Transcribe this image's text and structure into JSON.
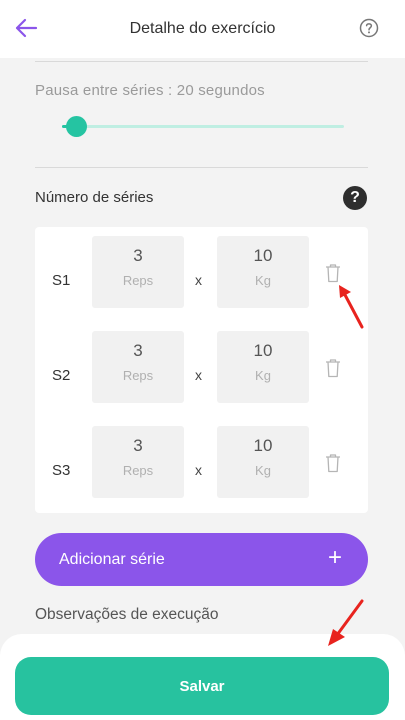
{
  "header": {
    "title": "Detalhe do exercício",
    "back_icon": "arrow-left-icon",
    "help_icon": "help-circle-icon",
    "accent_color": "#8b55ea"
  },
  "rest": {
    "label": "Pausa entre séries : 20 segundos",
    "slider_level_fraction": 0.05,
    "color": "#25c4a2"
  },
  "series": {
    "title": "Número de séries",
    "help_glyph": "?",
    "times_sign": "x",
    "rows": [
      {
        "label": "S1",
        "reps": "3",
        "reps_unit": "Reps",
        "weight": "10",
        "weight_unit": "Kg"
      },
      {
        "label": "S2",
        "reps": "3",
        "reps_unit": "Reps",
        "weight": "10",
        "weight_unit": "Kg"
      },
      {
        "label": "S3",
        "reps": "3",
        "reps_unit": "Reps",
        "weight": "10",
        "weight_unit": "Kg"
      }
    ]
  },
  "add_series": {
    "label": "Adicionar série",
    "icon": "+"
  },
  "observations": {
    "label": "Observações de execução"
  },
  "footer": {
    "save_label": "Salvar",
    "save_color": "#27c29f"
  },
  "annotations": {
    "color": "#e8231e"
  }
}
